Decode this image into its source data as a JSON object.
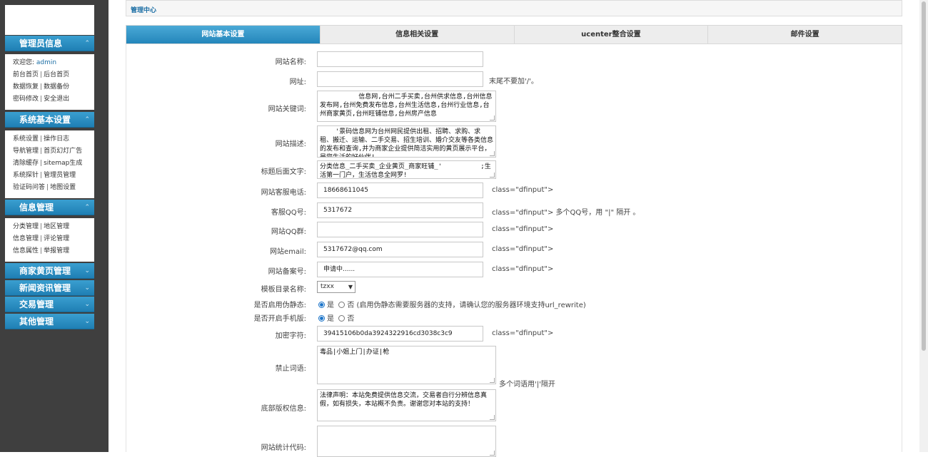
{
  "sidebar": {
    "sections": [
      {
        "title": "管理员信息",
        "rows": [
          [
            "欢迎您: ",
            "admin"
          ],
          [
            "前台首页",
            "后台首页"
          ],
          [
            "数据恢复",
            "数据备份"
          ],
          [
            "密码修改",
            "安全退出"
          ]
        ]
      },
      {
        "title": "系统基本设置",
        "rows": [
          [
            "系统设置",
            "操作日志"
          ],
          [
            "导航管理",
            "首页幻灯广告"
          ],
          [
            "清除缓存",
            "sitemap生成"
          ],
          [
            "系统探针",
            "管理员管理"
          ],
          [
            "验证码问答",
            "地图设置"
          ]
        ]
      },
      {
        "title": "信息管理",
        "rows": [
          [
            "分类管理",
            "地区管理"
          ],
          [
            "信息管理",
            "评论管理"
          ],
          [
            "信息属性",
            "举报管理"
          ]
        ]
      },
      {
        "title": "商家黄页管理"
      },
      {
        "title": "新闻资讯管理"
      },
      {
        "title": "交易管理"
      },
      {
        "title": "其他管理"
      }
    ],
    "chev_up": "⌃",
    "chev_down": "⌄"
  },
  "header": {
    "title": "管理中心"
  },
  "tabs": [
    "网站基本设置",
    "信息相关设置",
    "ucenter整合设置",
    "邮件设置"
  ],
  "form": {
    "site_name": {
      "label": "网站名称:",
      "value": ""
    },
    "site_url": {
      "label": "网址:",
      "value": "",
      "hint": "末尾不要加'/'。"
    },
    "keywords": {
      "label": "网站关键词:",
      "value": "          信息网,台州二手买卖,台州供求信息,台州信息发布网,台州免费发布信息,台州生活信息,台州行业信息,台州商家黄页,台州旺铺信息,台州房产信息"
    },
    "description": {
      "label": "网站描述:",
      "value": "    '景码信息网为台州网民提供出租、招聘、求购、求租、搬迁、运输、二手交易、招生培训、婚介交友等各类信息的发布和查询,并为商家企业提供简洁实用的黄页展示平台，是您生活的好伙伴!"
    },
    "title_suffix": {
      "label": "标题后面文字:",
      "value": "分类信息_二手买卖_企业黄页_商家旺铺_'          ;生活第一门户，生活信息全网罗!"
    },
    "service_phone": {
      "label": "网站客服电话:",
      "value": "18668611045",
      "hint": "class=\"dfinput\">"
    },
    "service_qq": {
      "label": "客服QQ号:",
      "value": "5317672",
      "hint": "class=\"dfinput\"> 多个QQ号，用 \"|\" 隔开 。"
    },
    "qq_group": {
      "label": "网站QQ群:",
      "value": "",
      "hint": "class=\"dfinput\">"
    },
    "email": {
      "label": "网站email:",
      "value": "5317672@qq.com",
      "hint": "class=\"dfinput\">"
    },
    "icp": {
      "label": "网站备案号:",
      "value": "申请中......",
      "hint": "class=\"dfinput\">"
    },
    "template": {
      "label": "模板目录名称:",
      "value": "tzxx"
    },
    "rewrite": {
      "label": "是否启用伪静态:",
      "yes": "是",
      "no": "否",
      "hint": "(启用伪静态需要服务器的支持，请确认您的服务器环境支持url_rewrite)"
    },
    "mobile": {
      "label": "是否开启手机版:",
      "yes": "是",
      "no": "否"
    },
    "encrypt": {
      "label": "加密字符:",
      "value": "39415106b0da3924322916cd3038c3c9",
      "hint": "class=\"dfinput\">"
    },
    "banned": {
      "label": "禁止词语:",
      "value": "毒品|小姐上门|办证|枪",
      "hint": "多个词语用'|'隔开"
    },
    "copyright": {
      "label": "底部版权信息:",
      "value": "法律声明：本站免费提供信息交流，交易者自行分辨信息真假，如有损失，本站概不负责。谢谢您对本站的支持！"
    },
    "stats": {
      "label": "网站统计代码:",
      "value": ""
    }
  }
}
